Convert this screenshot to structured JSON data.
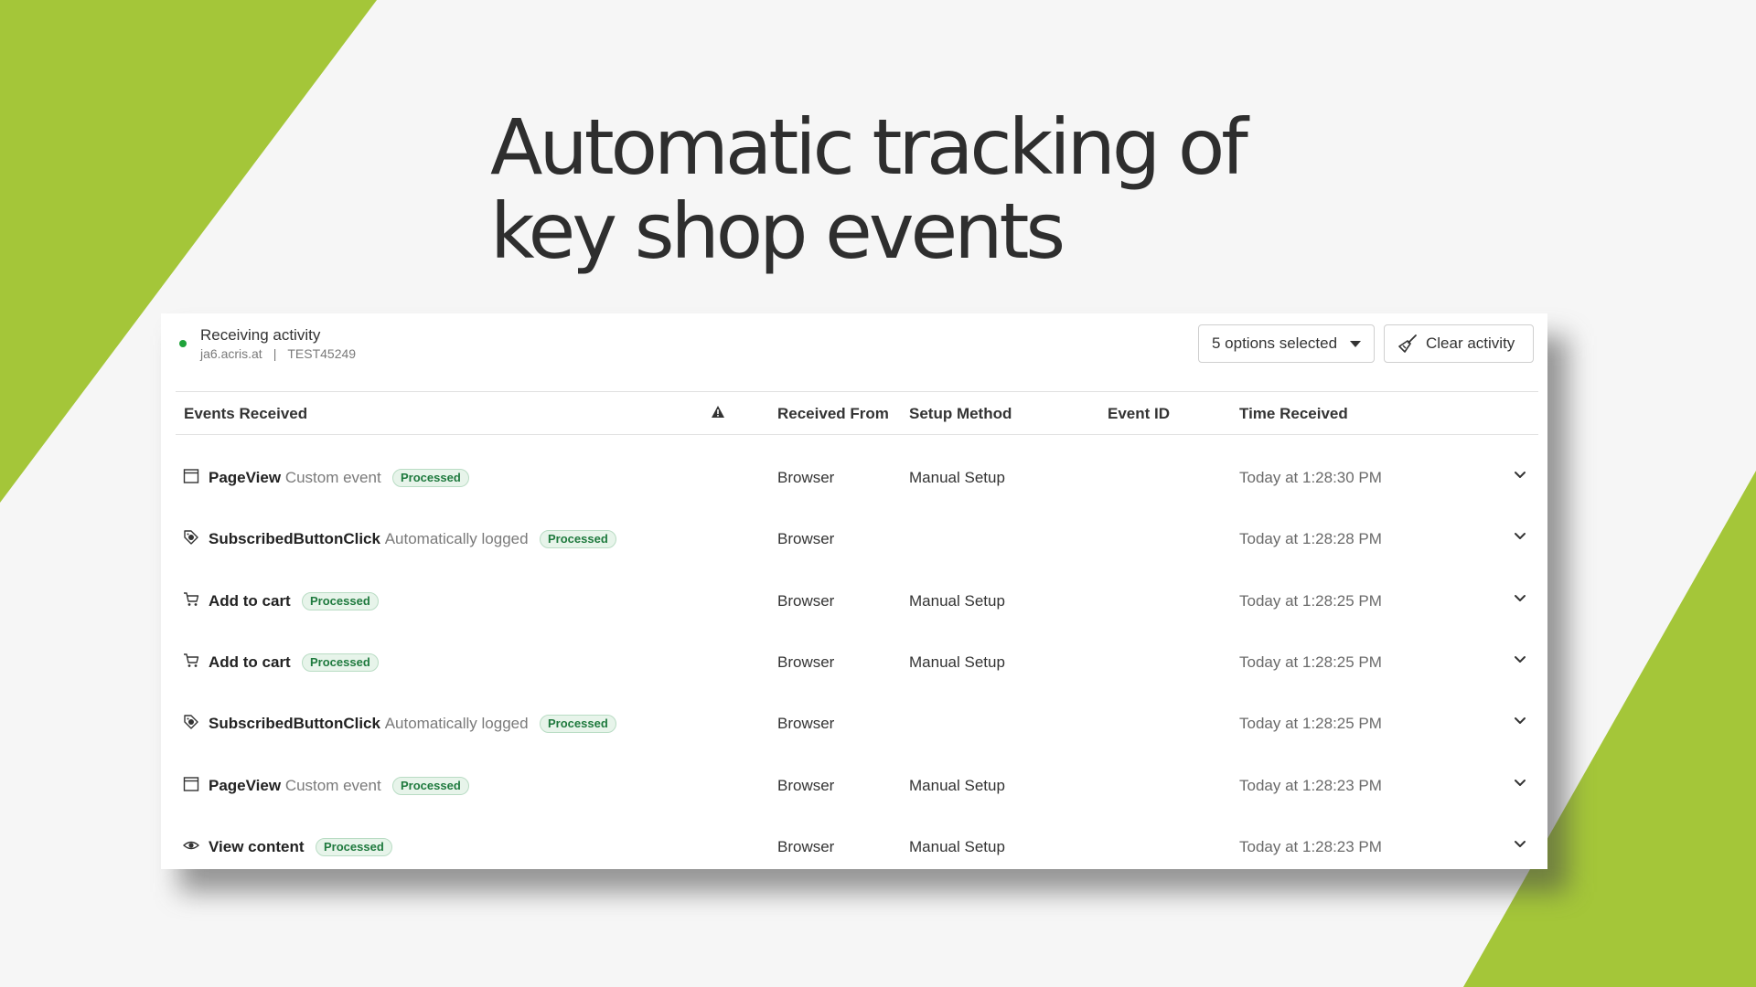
{
  "slide": {
    "headline_line1": "Automatic tracking of",
    "headline_line2": "key shop events",
    "accent_color": "#a4c639"
  },
  "status": {
    "title": "Receiving activity",
    "domain": "ja6.acris.at",
    "separator": "|",
    "id": "TEST45249",
    "dot_color": "#1fa33a"
  },
  "toolbar": {
    "select_label": "5 options selected",
    "clear_label": "Clear activity"
  },
  "table": {
    "headers": {
      "events": "Events Received",
      "received_from": "Received From",
      "setup_method": "Setup Method",
      "event_id": "Event ID",
      "time_received": "Time Received"
    },
    "rows": [
      {
        "icon": "page-icon",
        "name": "PageView",
        "desc": "Custom event",
        "status": "Processed",
        "from": "Browser",
        "method": "Manual Setup",
        "event_id": "",
        "time": "Today at 1:28:30 PM"
      },
      {
        "icon": "tag-icon",
        "name": "SubscribedButtonClick",
        "desc": "Automatically logged",
        "status": "Processed",
        "from": "Browser",
        "method": "",
        "event_id": "",
        "time": "Today at 1:28:28 PM"
      },
      {
        "icon": "cart-icon",
        "name": "Add to cart",
        "desc": "",
        "status": "Processed",
        "from": "Browser",
        "method": "Manual Setup",
        "event_id": "",
        "time": "Today at 1:28:25 PM"
      },
      {
        "icon": "cart-icon",
        "name": "Add to cart",
        "desc": "",
        "status": "Processed",
        "from": "Browser",
        "method": "Manual Setup",
        "event_id": "",
        "time": "Today at 1:28:25 PM"
      },
      {
        "icon": "tag-icon",
        "name": "SubscribedButtonClick",
        "desc": "Automatically logged",
        "status": "Processed",
        "from": "Browser",
        "method": "",
        "event_id": "",
        "time": "Today at 1:28:25 PM"
      },
      {
        "icon": "page-icon",
        "name": "PageView",
        "desc": "Custom event",
        "status": "Processed",
        "from": "Browser",
        "method": "Manual Setup",
        "event_id": "",
        "time": "Today at 1:28:23 PM"
      },
      {
        "icon": "eye-icon",
        "name": "View content",
        "desc": "",
        "status": "Processed",
        "from": "Browser",
        "method": "Manual Setup",
        "event_id": "",
        "time": "Today at 1:28:23 PM"
      }
    ]
  }
}
